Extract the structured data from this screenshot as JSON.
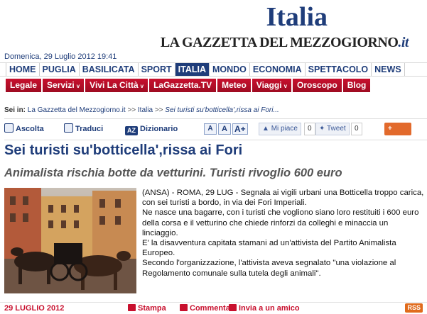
{
  "header": {
    "section_title": "Italia",
    "brand_prefix": "LA GAZZETTA DEL MEZZOGIORNO",
    "brand_suffix": ".it",
    "date": "Domenica, 29 Luglio 2012 19:41"
  },
  "nav_primary": [
    "HOME",
    "PUGLIA",
    "BASILICATA",
    "SPORT",
    "ITALIA",
    "MONDO",
    "ECONOMIA",
    "SPETTACOLO",
    "NEWS"
  ],
  "nav_secondary": [
    {
      "label": "Legale",
      "chevron": ""
    },
    {
      "label": "Servizi",
      "chevron": "v"
    },
    {
      "label": "Vivi La Città",
      "chevron": "v"
    },
    {
      "label": "LaGazzetta.TV",
      "chevron": ""
    },
    {
      "label": "Meteo",
      "chevron": ""
    },
    {
      "label": "Viaggi",
      "chevron": "v"
    },
    {
      "label": "Oroscopo",
      "chevron": ""
    },
    {
      "label": "Blog",
      "chevron": ""
    }
  ],
  "breadcrumb": {
    "prefix": "Sei in:",
    "link1": "La Gazzetta del Mezzogiorno.it",
    "sep": ">>",
    "link2": "Italia",
    "current": "Sei turisti su'botticella',rissa ai Fori..."
  },
  "toolbar": {
    "listen": "Ascolta",
    "translate": "Traduci",
    "dictionary": "Dizionario",
    "az_icon_text": "AZ",
    "font_small": "A",
    "font_medium": "A",
    "font_large": "A+",
    "like_label": "Mi piace",
    "like_count": "0",
    "tweet_label": "Tweet",
    "tweet_count": "0",
    "share_label": "Share"
  },
  "article": {
    "headline": "Sei turisti su'botticella',rissa ai Fori",
    "subtitle": "Animalista rischia botte da vetturini. Turisti rivoglio 600 euro",
    "paragraphs": [
      "(ANSA) - ROMA, 29 LUG - Segnala ai vigili urbani una Botticella troppo carica, con sei turisti a bordo, in via dei Fori Imperiali.",
      "Ne nasce una bagarre, con i turisti che vogliono siano loro restituiti i 600 euro della corsa e il vetturino che chiede rinforzi da colleghi e minaccia un linciaggio.",
      "E' la disavventura capitata stamani ad un'attivista del Partito Animalista Europeo.",
      "Secondo l'organizzazione, l'attivista aveva segnalato \"una violazione al Regolamento comunale sulla tutela degli animali\"."
    ]
  },
  "footer": {
    "date": "29 LUGLIO 2012",
    "print": "Stampa",
    "comment": "Commenta",
    "send": "Invia a un amico",
    "rss": "RSS"
  },
  "colors": {
    "brand_blue": "#1f3d7a",
    "menu_red": "#c8102e",
    "share_orange": "#e26a2c"
  }
}
